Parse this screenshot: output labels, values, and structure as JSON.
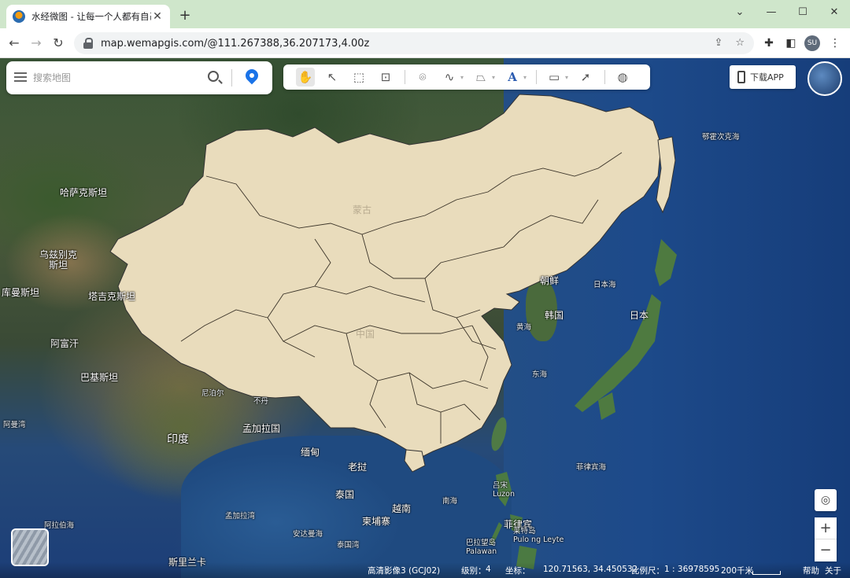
{
  "browser": {
    "tab_title": "水经微图 - 让每一个人都有自己的",
    "tab_close": "✕",
    "new_tab": "+",
    "url": "map.wemapgis.com/@111.267388,36.207173,4.00z",
    "profile_initials": "SU",
    "window_controls": [
      "⌄",
      "—",
      "☐",
      "✕"
    ]
  },
  "search": {
    "placeholder": "搜索地图"
  },
  "toolbar": {
    "tools": [
      "pan-hand-icon",
      "select-arrow-icon",
      "box-select-icon",
      "zoom-extent-icon",
      "marker-icon",
      "polyline-icon",
      "polygon-icon",
      "text-icon",
      "measure-ruler-icon",
      "info-cursor-icon",
      "globe-icon"
    ]
  },
  "download_button": "下载APP",
  "map_labels": {
    "kazakhstan": "哈萨克斯坦",
    "uzbekistan": "乌兹别克\n斯坦",
    "turkmenistan": "库曼斯坦",
    "tajikistan": "塔吉克斯坦",
    "afghanistan": "阿富汗",
    "pakistan": "巴基斯坦",
    "india": "印度",
    "nepal": "尼泊尔",
    "bhutan": "不丹",
    "bangladesh": "孟加拉国",
    "myanmar": "缅甸",
    "laos": "老挝",
    "thailand": "泰国",
    "vietnam": "越南",
    "cambodia": "柬埔寨",
    "mongolia": "蒙古",
    "china": "中国",
    "north_korea": "朝鲜",
    "south_korea": "韩国",
    "japan": "日本",
    "sea_of_japan": "日本海",
    "yellow_sea": "黄海",
    "east_sea": "东海",
    "okhotsk": "鄂霍次克海",
    "south_sea": "南海",
    "philippine_sea": "菲律宾海",
    "philippines": "菲律宾",
    "luzon": "吕宋\nLuzon",
    "palawan": "巴拉望岛\nPalawan",
    "bay_bengal": "孟加拉湾",
    "arabian_sea": "阿拉伯海",
    "andaman": "安达曼海",
    "thai_gulf": "泰国湾",
    "sri_lanka": "斯里兰卡",
    "mindanao": "棉兰老岛\nMindanao",
    "leyte": "莱特岛\nPulo ng Leyte",
    "gulf_oman": "阿曼湾",
    "laccadive": "拉克代夫海",
    "south_sea_2": "南海"
  },
  "status": {
    "layer": "高清影像3 (GCJ02)",
    "level_label": "级别：",
    "level": "4",
    "coord_label": "坐标：",
    "coords": "120.71563, 34.450532",
    "scale_label": "比例尺：",
    "scale": "1 : 36978595",
    "scale_bar": "200千米",
    "help": "帮助",
    "about": "关于"
  },
  "zoom": {
    "locate": "◎",
    "zoom_in": "+",
    "zoom_out": "−"
  }
}
